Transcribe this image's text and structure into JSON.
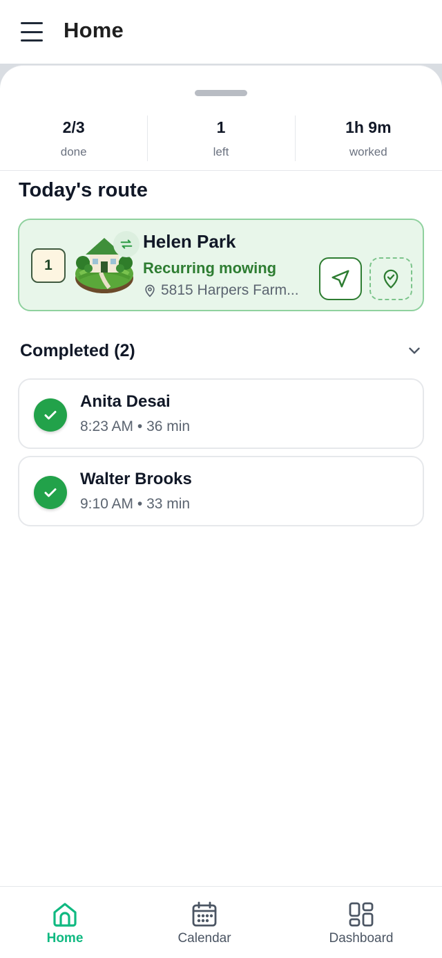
{
  "header": {
    "title": "Home",
    "menu_icon": "hamburger-icon"
  },
  "stats": [
    {
      "value": "2/3",
      "label": "done"
    },
    {
      "value": "1",
      "label": "left"
    },
    {
      "value": "1h 9m",
      "label": "worked"
    }
  ],
  "route": {
    "section_title": "Today's route",
    "stop": {
      "number": "1",
      "client": "Helen Park",
      "service": "Recurring mowing",
      "address": "5815 Harpers Farm...",
      "icons": [
        "house-lawn-icon",
        "recurring-icon",
        "location-pin-icon",
        "navigate-icon",
        "check-in-pin-icon"
      ]
    }
  },
  "completed": {
    "title": "Completed (2)",
    "jobs": [
      {
        "client": "Anita Desai",
        "meta": "8:23 AM • 36 min"
      },
      {
        "client": "Walter Brooks",
        "meta": "9:10 AM • 33 min"
      }
    ]
  },
  "bottom_nav": [
    {
      "label": "Home",
      "icon": "home-icon",
      "active": true
    },
    {
      "label": "Calendar",
      "icon": "calendar-icon",
      "active": false
    },
    {
      "label": "Dashboard",
      "icon": "dashboard-icon",
      "active": false
    }
  ],
  "colors": {
    "accent": "#10b981",
    "brand_green": "#2e7d32",
    "route_card_bg": "#e8f6ea",
    "completed_check": "#22a24a"
  }
}
